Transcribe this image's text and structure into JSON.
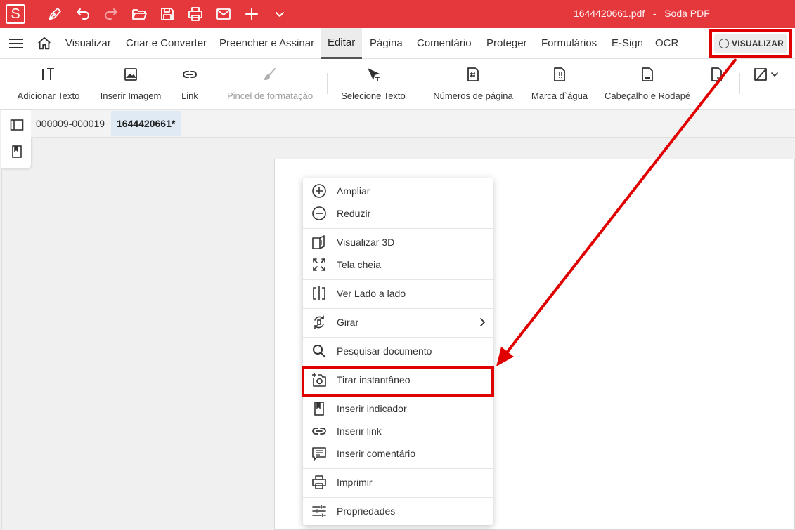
{
  "app": {
    "logo_letter": "S",
    "window_title": "1644420661.pdf   -   Soda PDF",
    "quick_access": [
      "pen-icon",
      "undo-icon",
      "redo-icon",
      "open-folder-icon",
      "save-icon",
      "print-icon",
      "mail-icon",
      "plus-icon",
      "chevron-down-icon"
    ]
  },
  "menubar": {
    "items": [
      "Visualizar",
      "Criar e Converter",
      "Preencher e Assinar",
      "Editar",
      "Página",
      "Comentário",
      "Proteger",
      "Formulários",
      "E-Sign",
      "OCR"
    ],
    "active": "Editar",
    "mode_button": "VISUALIZAR"
  },
  "ribbon": {
    "tools": [
      {
        "label": "Adicionar Texto",
        "icon": "text-tool-icon"
      },
      {
        "label": "Inserir Imagem",
        "icon": "image-icon"
      },
      {
        "label": "Link",
        "icon": "link-icon"
      },
      {
        "label": "Pincel de formatação",
        "icon": "brush-icon",
        "disabled": true
      },
      {
        "label": "Selecione Texto",
        "icon": "select-text-icon"
      },
      {
        "label": "Números de página",
        "icon": "page-number-icon"
      },
      {
        "label": "Marca d`água",
        "icon": "watermark-icon"
      },
      {
        "label": "Cabeçalho e Rodapé",
        "icon": "header-footer-icon"
      }
    ]
  },
  "tabs": [
    {
      "label": "000009-000019",
      "active": false
    },
    {
      "label": "1644420661*",
      "active": true
    }
  ],
  "context_menu": {
    "items": [
      {
        "label": "Ampliar",
        "icon": "zoom-in-icon"
      },
      {
        "label": "Reduzir",
        "icon": "zoom-out-icon"
      },
      {
        "label": "Visualizar 3D",
        "icon": "view-3d-icon"
      },
      {
        "label": "Tela cheia",
        "icon": "fullscreen-icon"
      },
      {
        "label": "Ver Lado a lado",
        "icon": "side-by-side-icon"
      },
      {
        "label": "Girar",
        "icon": "rotate-icon"
      },
      {
        "label": "Pesquisar documento",
        "icon": "search-icon"
      },
      {
        "label": "Tirar instantâneo",
        "icon": "snapshot-icon"
      },
      {
        "label": "Inserir indicador",
        "icon": "bookmark-icon"
      },
      {
        "label": "Inserir link",
        "icon": "link-icon"
      },
      {
        "label": "Inserir comentário",
        "icon": "comment-icon"
      },
      {
        "label": "Imprimir",
        "icon": "print-icon"
      },
      {
        "label": "Propriedades",
        "icon": "properties-icon"
      }
    ]
  },
  "colors": {
    "brand_red": "#e5383d",
    "annotation_red": "#e00000",
    "active_tab_bg": "#dfeaf5"
  }
}
